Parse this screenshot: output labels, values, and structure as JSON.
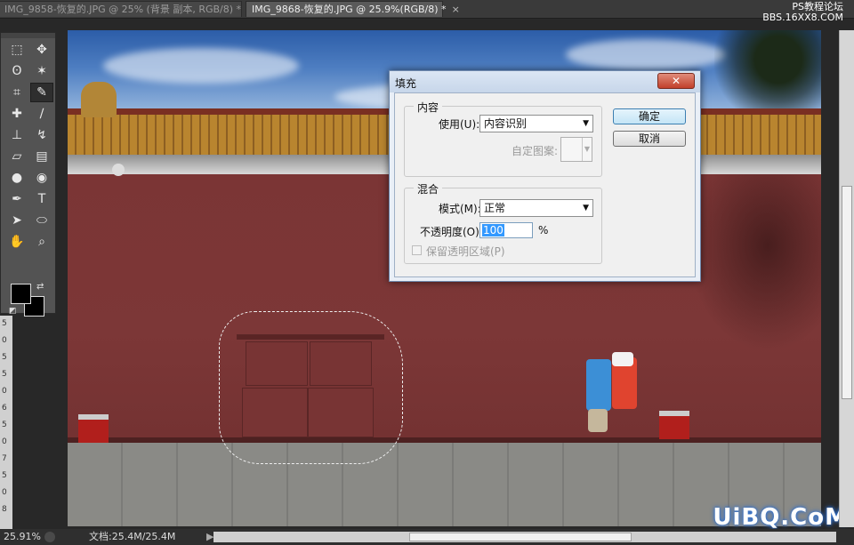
{
  "tabs": [
    {
      "label": "IMG_9858-恢复的.JPG @ 25% (背景 副本, RGB/8) *",
      "close": "×"
    },
    {
      "label": "IMG_9868-恢复的.JPG @ 25.9%(RGB/8) *",
      "close": "×"
    }
  ],
  "watermark_top": {
    "line1": "PS教程论坛",
    "line2": "BBS.16XX8.COM"
  },
  "tools": [
    {
      "name": "rectangular-marquee-tool",
      "glyph": "⬚"
    },
    {
      "name": "move-tool",
      "glyph": "✥"
    },
    {
      "name": "lasso-tool",
      "glyph": "ʘ"
    },
    {
      "name": "magic-wand-tool",
      "glyph": "✶"
    },
    {
      "name": "crop-tool",
      "glyph": "⌗"
    },
    {
      "name": "eyedropper-tool",
      "glyph": "✎"
    },
    {
      "name": "healing-brush-tool",
      "glyph": "✚"
    },
    {
      "name": "brush-tool",
      "glyph": "∕"
    },
    {
      "name": "clone-stamp-tool",
      "glyph": "⊥"
    },
    {
      "name": "history-brush-tool",
      "glyph": "↯"
    },
    {
      "name": "eraser-tool",
      "glyph": "▱"
    },
    {
      "name": "gradient-tool",
      "glyph": "▤"
    },
    {
      "name": "blur-tool",
      "glyph": "●"
    },
    {
      "name": "dodge-tool",
      "glyph": "◉"
    },
    {
      "name": "pen-tool",
      "glyph": "✒"
    },
    {
      "name": "type-tool",
      "glyph": "T"
    },
    {
      "name": "path-selection-tool",
      "glyph": "➤"
    },
    {
      "name": "ellipse-tool",
      "glyph": "⬭"
    },
    {
      "name": "hand-tool",
      "glyph": "✋"
    },
    {
      "name": "zoom-tool",
      "glyph": "⌕"
    },
    {
      "name": "quick-mask-icon",
      "glyph": "◘"
    },
    {
      "name": "screen-mode-icon",
      "glyph": "▣"
    }
  ],
  "ruler_ticks": [
    "5",
    "0",
    "5",
    "5",
    "0",
    "6",
    "5",
    "0",
    "7",
    "5",
    "0",
    "8"
  ],
  "status": {
    "zoom": "25.91%",
    "doc": "文档:25.4M/25.4M",
    "arrow": "▶"
  },
  "watermark_bottom": "UiBQ.CoM",
  "dialog": {
    "title": "填充",
    "close": "✕",
    "content_group": "内容",
    "use_label": "使用(U):",
    "use_value": "内容识别",
    "custom_pattern_label": "自定图案:",
    "blend_group": "混合",
    "mode_label": "模式(M):",
    "mode_value": "正常",
    "opacity_label": "不透明度(O):",
    "opacity_value": "100",
    "opacity_unit": "%",
    "preserve_label": "保留透明区域(P)",
    "ok": "确定",
    "cancel": "取消"
  }
}
